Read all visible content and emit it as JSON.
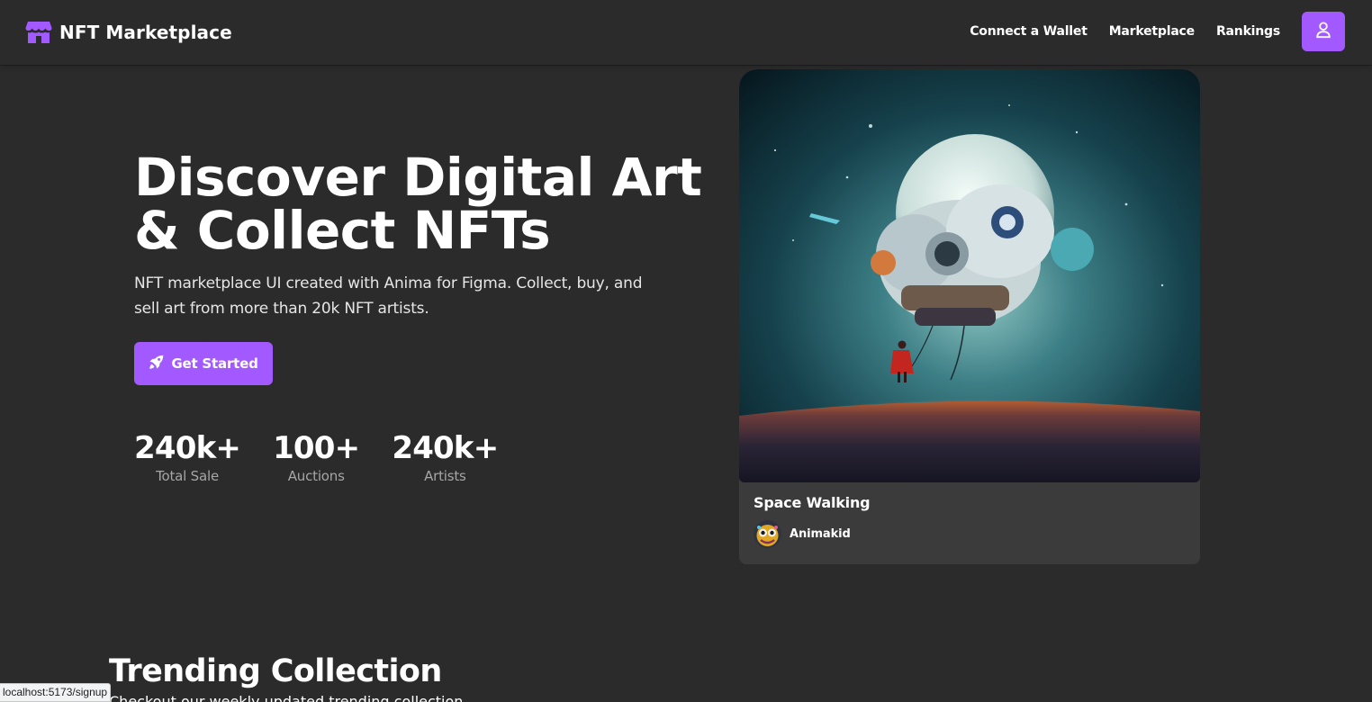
{
  "header": {
    "brand": "NFT Marketplace",
    "nav": [
      "Connect a Wallet",
      "Marketplace",
      "Rankings"
    ],
    "user_icon": "user-icon",
    "logo_icon": "storefront-icon"
  },
  "hero": {
    "title_line1": "Discover Digital Art",
    "title_line2": "& Collect NFTs",
    "description": "NFT marketplace UI created with Anima for Figma. Collect, buy, and sell art from more than 20k NFT artists.",
    "cta_label": "Get Started",
    "cta_icon": "rocket-icon",
    "stats": [
      {
        "value": "240k+",
        "label": "Total Sale"
      },
      {
        "value": "100+",
        "label": "Auctions"
      },
      {
        "value": "240k+",
        "label": "Artists"
      }
    ]
  },
  "featured": {
    "title": "Space Walking",
    "artist": "Animakid"
  },
  "trending": {
    "title": "Trending Collection",
    "subtitle": "Checkout our weekly updated trending collection."
  },
  "status_bar": {
    "url": "localhost:5173/signup"
  },
  "colors": {
    "accent": "#a259ff",
    "background": "#2b2b2b",
    "card": "#3b3b3b",
    "muted": "#a6a6a6"
  }
}
